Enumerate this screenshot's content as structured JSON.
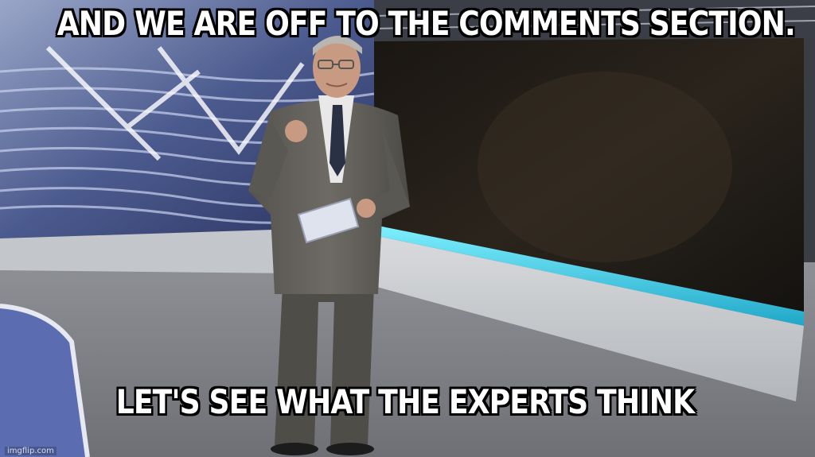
{
  "meme": {
    "top_caption": "AND WE ARE OFF TO THE COMMENTS SECTION.",
    "bottom_caption": "LET'S SEE WHAT THE EXPERTS THINK",
    "watermark": "imgflip.com"
  },
  "colors": {
    "caption_fill": "#ffffff",
    "caption_outline": "#000000",
    "studio_accent": "#3fd6ee"
  }
}
